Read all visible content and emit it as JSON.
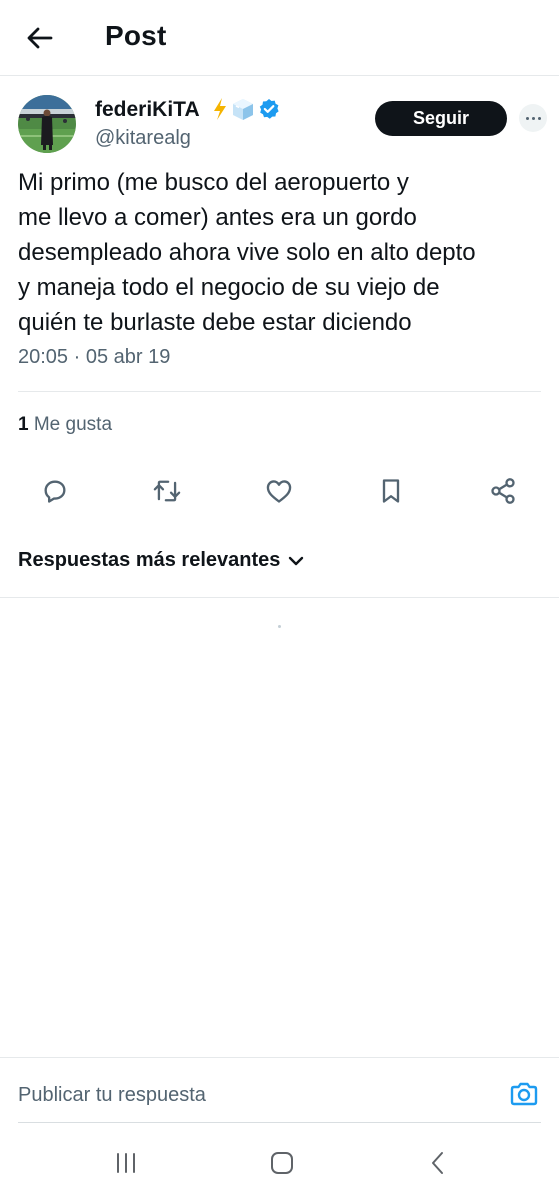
{
  "header": {
    "title": "Post",
    "back_icon": "arrow-left-icon"
  },
  "author": {
    "display_name": "federiKiTA",
    "handle": "@kitarealg",
    "badges": [
      "lightning-emoji-icon",
      "ice-cube-emoji-icon",
      "verified-badge-icon"
    ],
    "verified_color": "#1d9bf0"
  },
  "follow_button": {
    "label": "Seguir"
  },
  "tweet": {
    "lines": [
      "Mi primo (me busco del aeropuerto y",
      "me llevo a comer)  antes era un gordo",
      "desempleado ahora vive solo en alto depto",
      "y maneja todo el negocio de su viejo de",
      "quién te burlaste debe estar diciendo"
    ],
    "timestamp": "20:05 · 05 abr 19"
  },
  "stats": {
    "likes_count": "1",
    "likes_label": "Me gusta"
  },
  "actions": [
    "reply-icon",
    "retweet-icon",
    "like-icon",
    "bookmark-icon",
    "share-icon"
  ],
  "replies": {
    "sort_label": "Respuestas más relevantes",
    "sort_icon": "chevron-down-icon"
  },
  "compose": {
    "placeholder": "Publicar tu respuesta",
    "camera_icon": "camera-icon",
    "accent": "#1d9bf0"
  },
  "system_nav": [
    "recent-apps-icon",
    "home-icon",
    "back-icon"
  ],
  "colors": {
    "text": "#0f1419",
    "muted": "#536471",
    "divider": "#e6e9eb",
    "follow_bg": "#0f1419"
  }
}
